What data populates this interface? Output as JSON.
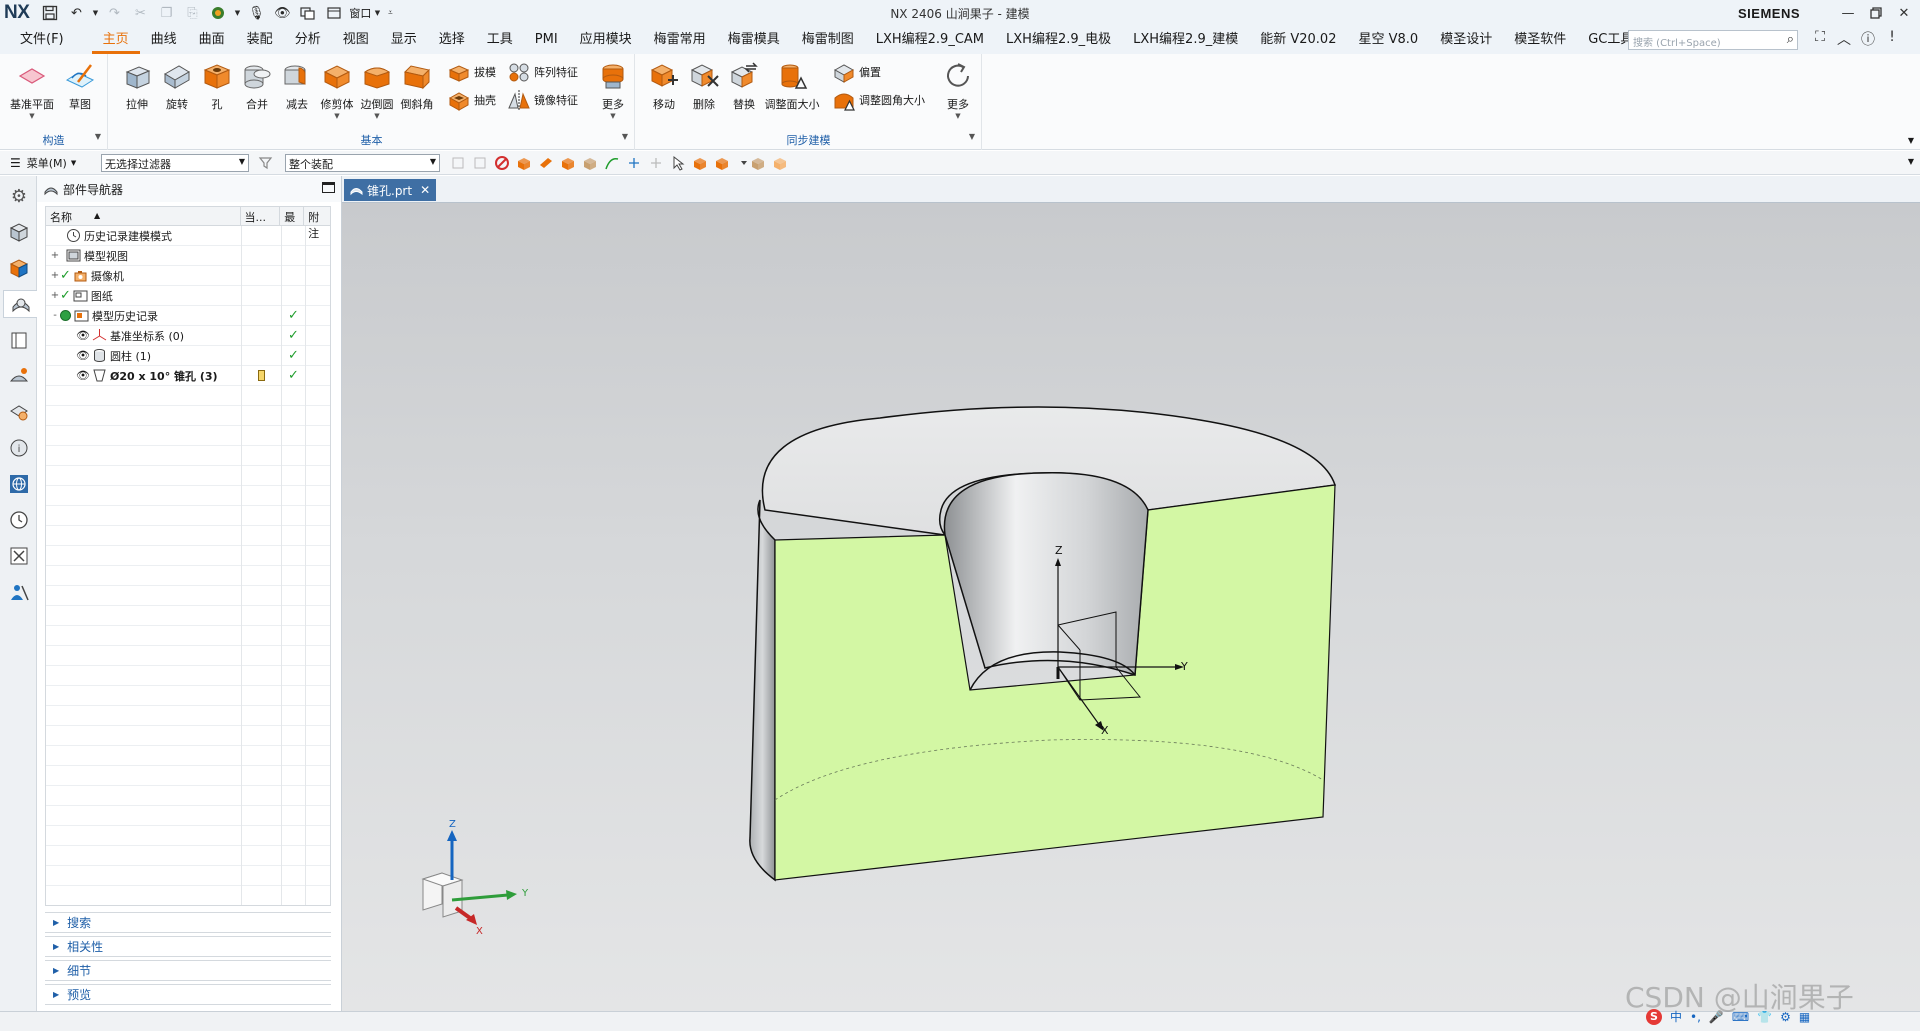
{
  "titlebar": {
    "logo": "NX",
    "title": "NX 2406 山涧果子 - 建模",
    "brand": "SIEMENS",
    "window_menu_label": "窗口"
  },
  "menu": {
    "file_label": "文件(F)",
    "tabs": [
      {
        "label": "主页",
        "active": true
      },
      {
        "label": "曲线"
      },
      {
        "label": "曲面"
      },
      {
        "label": "装配"
      },
      {
        "label": "分析"
      },
      {
        "label": "视图"
      },
      {
        "label": "显示"
      },
      {
        "label": "选择"
      },
      {
        "label": "工具"
      },
      {
        "label": "PMI"
      },
      {
        "label": "应用模块"
      },
      {
        "label": "梅雷常用"
      },
      {
        "label": "梅雷模具"
      },
      {
        "label": "梅雷制图"
      },
      {
        "label": "LXH编程2.9_CAM"
      },
      {
        "label": "LXH编程2.9_电极"
      },
      {
        "label": "LXH编程2.9_建模"
      },
      {
        "label": "能新 V20.02"
      },
      {
        "label": "星空 V8.0"
      },
      {
        "label": "模圣设计"
      },
      {
        "label": "模圣软件"
      },
      {
        "label": "GC工具箱"
      }
    ],
    "search_placeholder": "搜索 (Ctrl+Space)"
  },
  "ribbon": {
    "groups": {
      "construct": "构造",
      "basic": "基本",
      "sync": "同步建模"
    },
    "buttons": {
      "datum_plane": "基准平面",
      "sketch": "草图",
      "extrude": "拉伸",
      "revolve": "旋转",
      "hole": "孔",
      "unite": "合并",
      "subtract": "减去",
      "trim_body": "修剪体",
      "edge_blend": "边倒圆",
      "chamfer": "倒斜角",
      "draft": "拔模",
      "pattern_feature": "阵列特征",
      "shell": "抽壳",
      "mirror_feature": "镜像特征",
      "more1": "更多",
      "move": "移动",
      "delete": "删除",
      "replace": "替换",
      "resize_face": "调整面大小",
      "offset": "偏置",
      "resize_blend": "调整圆角大小",
      "more2": "更多"
    }
  },
  "selbar": {
    "menu_label": "菜单(M)",
    "filter_value": "无选择过滤器",
    "scope_value": "整个装配"
  },
  "navigator": {
    "title": "部件导航器",
    "columns": {
      "name": "名称",
      "current": "当...",
      "latest": "最",
      "note": "附注"
    },
    "rows": [
      {
        "label": "历史记录建模模式",
        "indent": 0,
        "expander": "",
        "icon": "clock-icon",
        "visible": false,
        "check": false,
        "note": false,
        "bold": false
      },
      {
        "label": "模型视图",
        "indent": 0,
        "expander": "+",
        "icon": "model-views-icon",
        "visible": false,
        "check": false,
        "note": false,
        "bold": false
      },
      {
        "label": "摄像机",
        "indent": 0,
        "expander": "+",
        "icon": "camera-icon",
        "visible": false,
        "check": false,
        "note": false,
        "bold": false
      },
      {
        "label": "图纸",
        "indent": 0,
        "expander": "+",
        "icon": "drawing-icon",
        "visible": false,
        "check": false,
        "note": false,
        "bold": false
      },
      {
        "label": "模型历史记录",
        "indent": 0,
        "expander": "-",
        "icon": "history-folder-icon",
        "visible": false,
        "check": true,
        "note": false,
        "bold": false
      },
      {
        "label": "基准坐标系 (0)",
        "indent": 1,
        "expander": "",
        "icon": "datum-csys-icon",
        "visible": true,
        "check": true,
        "note": false,
        "bold": false
      },
      {
        "label": "圆柱 (1)",
        "indent": 1,
        "expander": "",
        "icon": "cylinder-icon",
        "visible": true,
        "check": true,
        "note": false,
        "bold": false
      },
      {
        "label": "Ø20 x 10° 锥孔 (3)",
        "indent": 1,
        "expander": "",
        "icon": "taper-hole-icon",
        "visible": true,
        "check": true,
        "note": true,
        "bold": true
      }
    ],
    "sections": [
      "搜索",
      "相关性",
      "细节",
      "预览"
    ]
  },
  "graphics": {
    "doc_tab": "锥孔.prt",
    "csys_labels": {
      "z": "Z",
      "y": "Y",
      "x": "X"
    },
    "triad_labels": {
      "z": "Z",
      "y": "Y",
      "x": "X"
    }
  },
  "watermark": "CSDN @山涧果子",
  "ime": {
    "logo": "S",
    "lang": "中",
    "punct": "•,"
  },
  "colors": {
    "accent": "#e8710a",
    "section_face": "#d3f7a4",
    "link_blue": "#1f5fa8",
    "check_green": "#1f9d2c"
  }
}
